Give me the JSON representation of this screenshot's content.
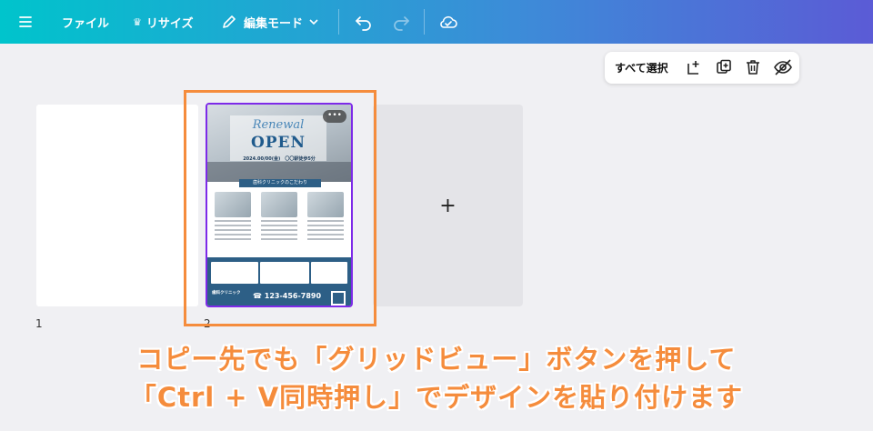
{
  "toolbar": {
    "file_label": "ファイル",
    "resize_label": "リサイズ",
    "edit_mode_label": "編集モード"
  },
  "actionbar": {
    "select_all_label": "すべて選択"
  },
  "pages": [
    {
      "number": "1"
    },
    {
      "number": "2"
    }
  ],
  "add_page_symbol": "+",
  "flyer": {
    "more_label": "•••",
    "renewal": "Renewal",
    "open": "OPEN",
    "date_text": "2024.00/00(金)　〇〇駅徒歩5分",
    "features_title": "歯科クリニックのこだわり",
    "phone": "☎ 123-456-7890",
    "clinic_name": "歯科クリニック"
  },
  "caption": {
    "line1": "コピー先でも「グリッドビュー」ボタンを押して",
    "line2": "「Ctrl + V同時押し」でデザインを貼り付けます"
  },
  "colors": {
    "accent_purple": "#7d2ae8",
    "highlight_orange": "#f58c3c",
    "toolbar_start": "#00c4cc",
    "toolbar_end": "#5b5bd6"
  }
}
